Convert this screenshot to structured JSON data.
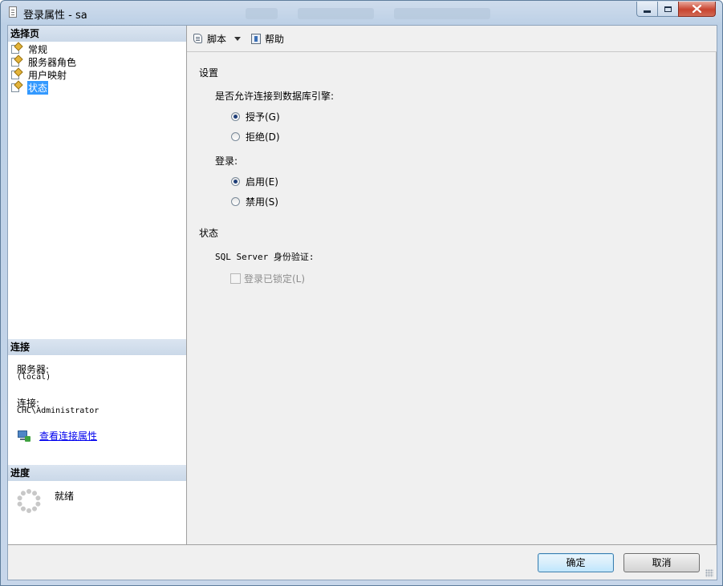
{
  "window": {
    "title": "登录属性 - sa"
  },
  "left_panel": {
    "select_page_header": "选择页",
    "pages": [
      {
        "label": "常规",
        "selected": false
      },
      {
        "label": "服务器角色",
        "selected": false
      },
      {
        "label": "用户映射",
        "selected": false
      },
      {
        "label": "状态",
        "selected": true
      }
    ],
    "connection_header": "连接",
    "server_label": "服务器:",
    "server_value": "(local)",
    "connection_label": "连接:",
    "connection_value": "CHC\\Administrator",
    "view_connection_link": "查看连接属性",
    "progress_header": "进度",
    "progress_status": "就绪"
  },
  "toolbar": {
    "script_label": "脚本",
    "help_label": "帮助"
  },
  "content": {
    "settings_header": "设置",
    "permission_question": "是否允许连接到数据库引擎:",
    "grant_label": "授予(G)",
    "deny_label": "拒绝(D)",
    "permission_selected": "grant",
    "login_label": "登录:",
    "enable_label": "启用(E)",
    "disable_label": "禁用(S)",
    "login_selected": "enable",
    "status_header": "状态",
    "sql_auth_label": "SQL Server 身份验证:",
    "locked_label": "登录已锁定(L)",
    "locked_checked": false,
    "locked_enabled": false
  },
  "footer": {
    "ok_label": "确定",
    "cancel_label": "取消"
  }
}
